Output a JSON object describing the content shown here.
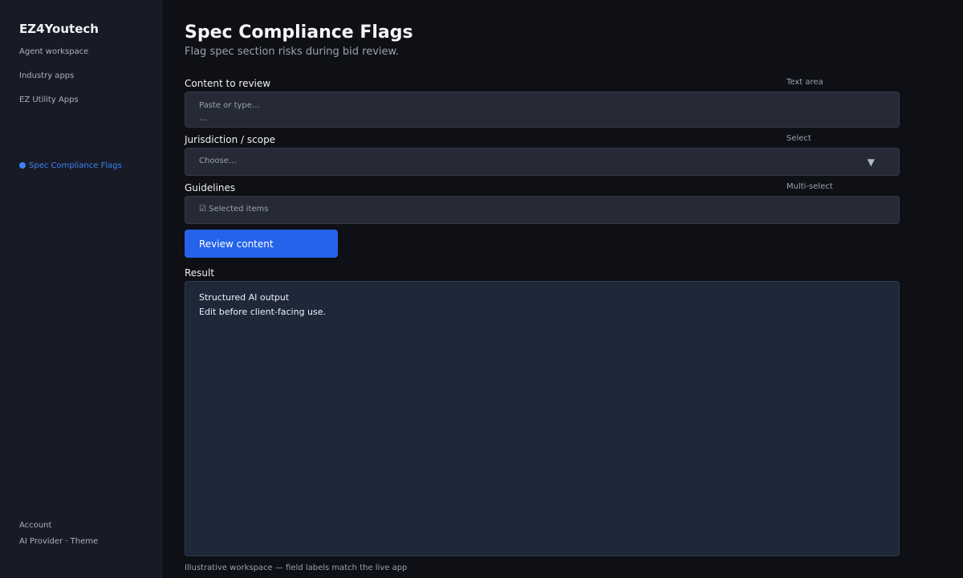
{
  "sidebar": {
    "brand": "EZ4Youtech",
    "nav": [
      "Agent workspace",
      "Industry apps",
      "EZ Utility Apps"
    ],
    "active_item": "Spec Compliance Flags",
    "footer": [
      "Account",
      "AI Provider · Theme"
    ]
  },
  "page": {
    "title": "Spec Compliance Flags",
    "subtitle": "Flag spec section risks during bid review."
  },
  "fields": {
    "content": {
      "label": "Content to review",
      "type": "Text area",
      "placeholder": "Paste or type…",
      "extra": "…"
    },
    "jurisdiction": {
      "label": "Jurisdiction / scope",
      "type": "Select",
      "placeholder": "Choose…",
      "arrow": "▼"
    },
    "guidelines": {
      "label": "Guidelines",
      "type": "Multi-select",
      "placeholder": "☑ Selected items"
    }
  },
  "action": {
    "label": "Review content"
  },
  "result": {
    "label": "Result",
    "line1": "Structured AI output",
    "line2": "Edit before client-facing use."
  },
  "footnote": "Illustrative workspace — field labels match the live app",
  "colors": {
    "accent": "#2563eb",
    "active_nav": "#3b82f6",
    "background": "#0e1016",
    "sidebar": "#181b25"
  }
}
